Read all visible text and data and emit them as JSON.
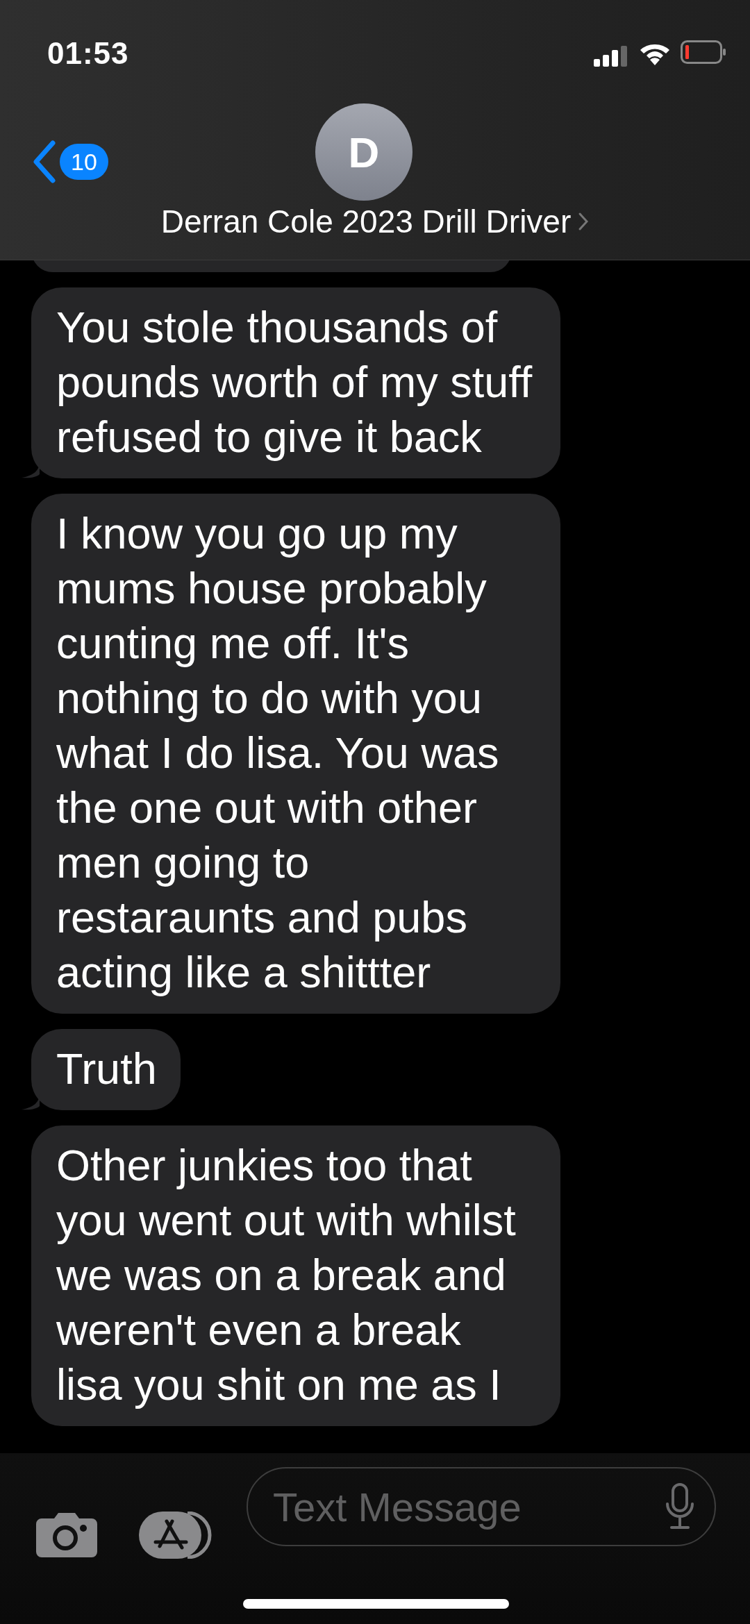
{
  "status_bar": {
    "time": "01:53"
  },
  "header": {
    "back_count": "10",
    "avatar_initial": "D",
    "contact_name": "Derran Cole 2023 Drill Driver"
  },
  "messages": [
    {
      "kind": "sliver",
      "tail": false
    },
    {
      "kind": "text",
      "text": "You stole thousands of pounds worth of my stuff refused to give it back",
      "tail": true
    },
    {
      "kind": "text",
      "text": "I know you go up my mums house probably cunting me off. It's nothing to do with you what I do lisa. You was the one out with other men going to restaraunts and pubs acting like a shittter",
      "tail": false
    },
    {
      "kind": "text",
      "text": "Truth",
      "tail": true
    },
    {
      "kind": "text",
      "text": "Other junkies too that you went out with whilst we was on a break and weren't even a break lisa you shit on me as I",
      "tail": false
    }
  ],
  "composer": {
    "placeholder": "Text Message"
  }
}
